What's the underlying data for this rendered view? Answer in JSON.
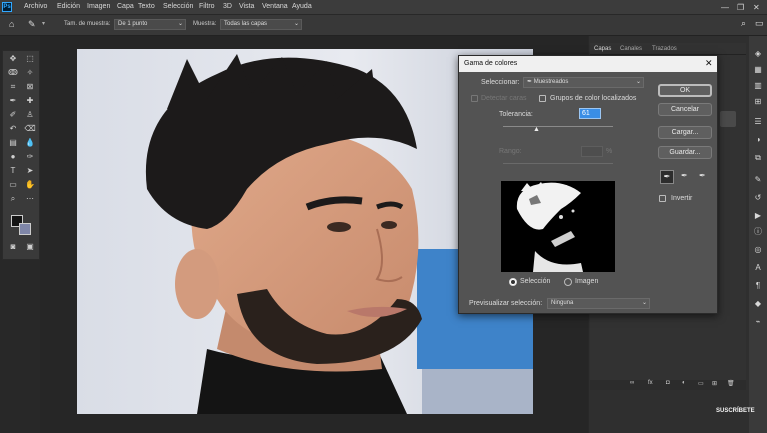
{
  "menubar": {
    "items": [
      "Archivo",
      "Edición",
      "Imagen",
      "Capa",
      "Texto",
      "Selección",
      "Filtro",
      "3D",
      "Vista",
      "Ventana",
      "Ayuda"
    ]
  },
  "options": {
    "sample_size_label": "Tam. de muestra:",
    "sample_size_value": "De 1 punto",
    "sample_label": "Muestra:",
    "sample_value": "Todas las capas"
  },
  "panels": {
    "tabs": [
      "Capas",
      "Canales",
      "Trazados"
    ]
  },
  "dialog": {
    "title": "Gama de colores",
    "select_label": "Seleccionar:",
    "select_value": "Muestreados",
    "detect_faces_label": "Detectar caras",
    "localized_label": "Grupos de color localizados",
    "tolerance_label": "Tolerancia:",
    "tolerance_value": "61",
    "tolerance_fraction": 0.3,
    "range_label": "Rango:",
    "range_unit": "%",
    "buttons": {
      "ok": "OK",
      "cancel": "Cancelar",
      "load": "Cargar...",
      "save": "Guardar..."
    },
    "invert_label": "Invertir",
    "view_selection_label": "Selección",
    "view_image_label": "Imagen",
    "preview_label": "Previsualizar selección:",
    "preview_value": "Ninguna"
  },
  "status": {
    "subscribe": "SUSCRÍBETE"
  },
  "colors": {
    "accent": "#3a8ee6",
    "dialog_bg": "#535353",
    "app_bg": "#282828"
  }
}
